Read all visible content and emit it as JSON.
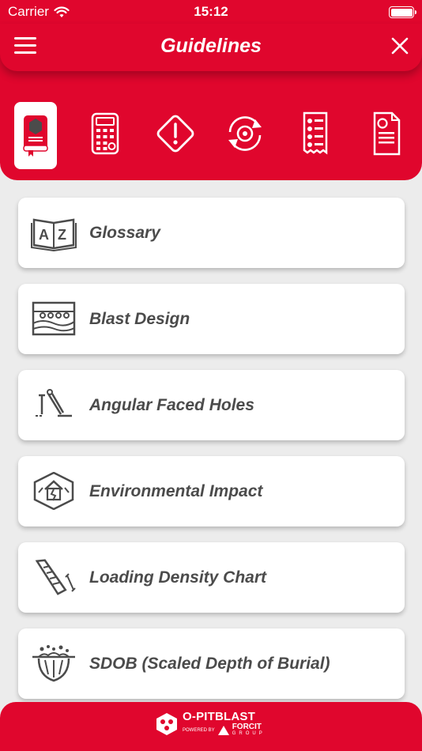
{
  "status_bar": {
    "carrier": "Carrier",
    "time": "15:12"
  },
  "header": {
    "title": "Guidelines"
  },
  "tabs": [
    {
      "icon": "book-icon",
      "active": true
    },
    {
      "icon": "calculator-icon",
      "active": false
    },
    {
      "icon": "warning-icon",
      "active": false
    },
    {
      "icon": "sync-icon",
      "active": false
    },
    {
      "icon": "checklist-icon",
      "active": false
    },
    {
      "icon": "document-icon",
      "active": false
    }
  ],
  "items": [
    {
      "label": "Glossary",
      "icon": "az-book-icon"
    },
    {
      "label": "Blast Design",
      "icon": "blast-design-icon"
    },
    {
      "label": "Angular Faced Holes",
      "icon": "angular-holes-icon"
    },
    {
      "label": "Environmental Impact",
      "icon": "environment-icon"
    },
    {
      "label": "Loading Density Chart",
      "icon": "loading-density-icon"
    },
    {
      "label": "SDOB (Scaled Depth of Burial)",
      "icon": "sdob-icon"
    }
  ],
  "footer": {
    "brand": "O-PITBLAST",
    "powered_by": "POWERED BY",
    "forcit": "FORCIT",
    "group": "GROUP"
  },
  "colors": {
    "primary": "#e0062d",
    "text": "#4b4b4b",
    "background": "#ececec"
  }
}
